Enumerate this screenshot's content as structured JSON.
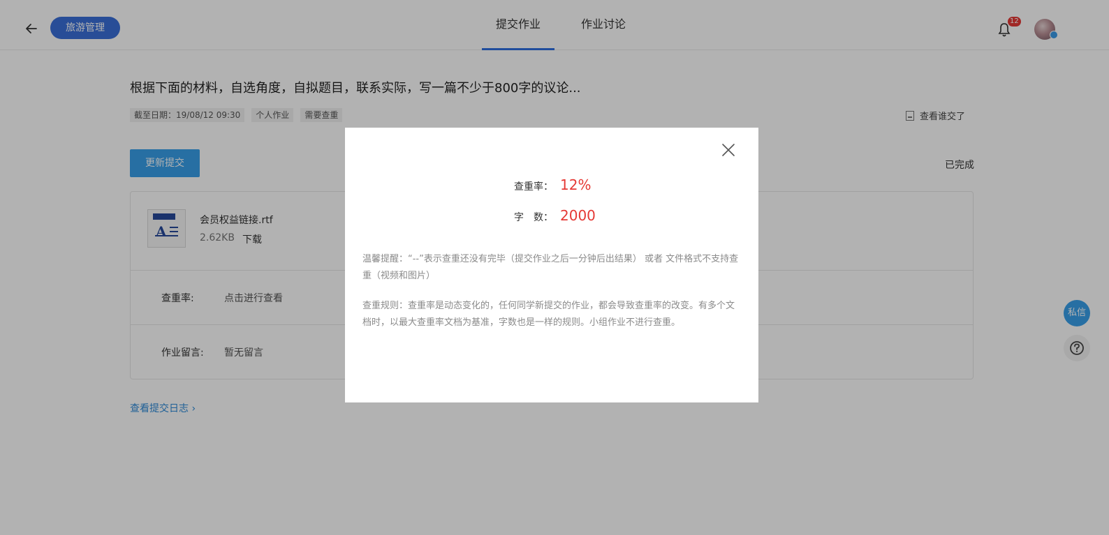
{
  "header": {
    "course": "旅游管理",
    "tabs": [
      "提交作业",
      "作业讨论"
    ],
    "notification_count": "12"
  },
  "assignment": {
    "title": "根据下面的材料，自选角度，自拟题目，联系实际，写一篇不少于800字的议论...",
    "meta": [
      "截至日期：19/08/12  09:30",
      "个人作业",
      "需要查重"
    ],
    "who_submitted": "查看谁交了",
    "update_button": "更新提交",
    "status": "已完成"
  },
  "file": {
    "name": "会员权益链接.rtf",
    "size": "2.62KB",
    "download": "下载",
    "icon_letter": "A"
  },
  "rows": {
    "duplicate_label": "查重率:",
    "duplicate_value": "点击进行查看",
    "message_label": "作业留言:",
    "message_value": "暂无留言"
  },
  "log_link": "查看提交日志",
  "floating": {
    "message": "私信"
  },
  "modal": {
    "dup_label": "查重率：",
    "dup_value": "12%",
    "words_label": "字　数：",
    "words_value": "2000",
    "tip": "温馨提醒：“--”表示查重还没有完毕（提交作业之后一分钟后出结果） 或者 文件格式不支持查重（视频和图片）",
    "rule": "查重规则：查重率是动态变化的，任何同学新提交的作业，都会导致查重率的改变。有多个文档时，以最大查重率文档为基准，字数也是一样的规则。小组作业不进行查重。"
  }
}
